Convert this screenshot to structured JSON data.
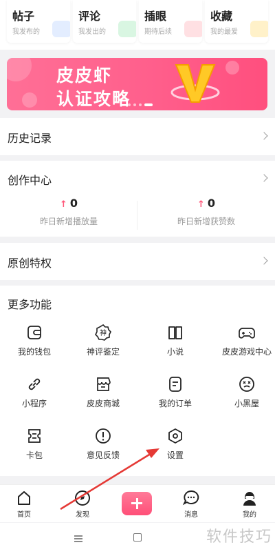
{
  "top_cards": [
    {
      "title": "帖子",
      "subtitle": "我发布的"
    },
    {
      "title": "评论",
      "subtitle": "我发出的"
    },
    {
      "title": "插眼",
      "subtitle": "期待后续"
    },
    {
      "title": "收藏",
      "subtitle": "我的最爱"
    }
  ],
  "banner": {
    "line1": "皮皮虾",
    "line2": "认证攻略",
    "badge": "V"
  },
  "history": {
    "label": "历史记录"
  },
  "creation": {
    "label": "创作中心",
    "stats": [
      {
        "value": "0",
        "label": "昨日新增播放量"
      },
      {
        "value": "0",
        "label": "昨日新增获赞数"
      }
    ]
  },
  "original": {
    "label": "原创特权"
  },
  "more": {
    "label": "更多功能",
    "items": [
      {
        "label": "我的钱包",
        "icon": "wallet-icon"
      },
      {
        "label": "神评鉴定",
        "icon": "shen-badge-icon"
      },
      {
        "label": "小说",
        "icon": "book-icon"
      },
      {
        "label": "皮皮游戏中心",
        "icon": "gamepad-icon"
      },
      {
        "label": "小程序",
        "icon": "link-icon"
      },
      {
        "label": "皮皮商城",
        "icon": "store-icon"
      },
      {
        "label": "我的订单",
        "icon": "order-icon"
      },
      {
        "label": "小黑屋",
        "icon": "dizzy-face-icon"
      },
      {
        "label": "卡包",
        "icon": "card-pack-icon"
      },
      {
        "label": "意见反馈",
        "icon": "feedback-icon"
      },
      {
        "label": "设置",
        "icon": "settings-icon"
      }
    ]
  },
  "nav": {
    "home": "首页",
    "discover": "发现",
    "messages": "消息",
    "mine": "我的"
  },
  "watermark": "软件技巧",
  "colors": {
    "accent": "#ff5578",
    "arrow": "#e53935"
  }
}
